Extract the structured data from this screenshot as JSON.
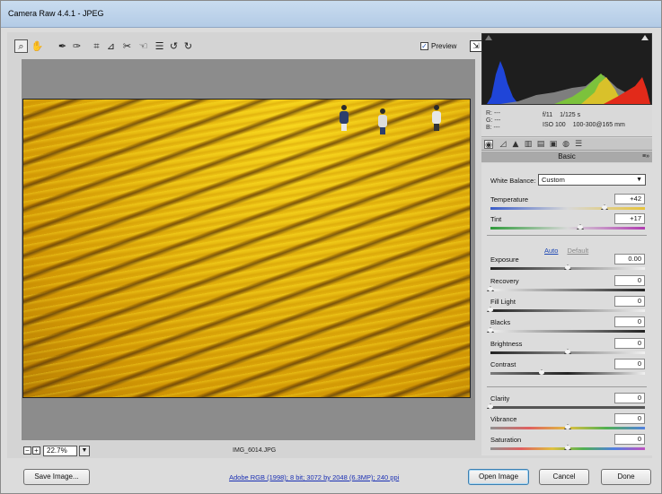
{
  "window": {
    "title": "Camera Raw 4.4.1  -  JPEG"
  },
  "toolbar": {
    "tools": [
      {
        "icon": "zoom-tool-icon",
        "glyph": "🔍",
        "active": true
      },
      {
        "icon": "hand-tool-icon",
        "glyph": "✋"
      },
      {
        "icon": "white-balance-tool-icon",
        "glyph": "✒"
      },
      {
        "icon": "color-sampler-tool-icon",
        "glyph": "✒"
      },
      {
        "icon": "crop-tool-icon",
        "glyph": "⌗"
      },
      {
        "icon": "straighten-tool-icon",
        "glyph": "⊿"
      },
      {
        "icon": "retouch-tool-icon",
        "glyph": "✂"
      },
      {
        "icon": "red-eye-tool-icon",
        "glyph": "☜"
      },
      {
        "icon": "preferences-icon",
        "glyph": "☰"
      },
      {
        "icon": "rotate-left-icon",
        "glyph": "↺"
      },
      {
        "icon": "rotate-right-icon",
        "glyph": "↻"
      }
    ],
    "preview_label": "Preview",
    "preview_checked": true
  },
  "status": {
    "zoom": "22.7%",
    "filename": "IMG_6014.JPG"
  },
  "readout": {
    "r": "R:  ---",
    "g": "G:  ---",
    "b": "B:  ---",
    "aperture": "f/11",
    "shutter": "1/125 s",
    "iso": "ISO 100",
    "lens": "100-300@165 mm"
  },
  "panel": {
    "title": "Basic",
    "white_balance_label": "White Balance:",
    "white_balance_value": "Custom",
    "auto_label": "Auto",
    "default_label": "Default",
    "sliders": [
      {
        "label": "Temperature",
        "value": "+42",
        "position": 0.74,
        "gradient": "linear-gradient(90deg,#3a5cc8,#d8d8d8 50%,#e7c33a)"
      },
      {
        "label": "Tint",
        "value": "+17",
        "position": 0.58,
        "gradient": "linear-gradient(90deg,#2e9a3a,#d8d8d8 50%,#b03ab0)"
      },
      {
        "label": "Exposure",
        "value": "0.00",
        "position": 0.5,
        "gradient": "linear-gradient(90deg,#222,#f0f0f0)"
      },
      {
        "label": "Recovery",
        "value": "0",
        "position": 0.0,
        "gradient": "linear-gradient(90deg,#f0f0f0,#222)"
      },
      {
        "label": "Fill Light",
        "value": "0",
        "position": 0.0,
        "gradient": "linear-gradient(90deg,#222,#f0f0f0)"
      },
      {
        "label": "Blacks",
        "value": "0",
        "position": 0.0,
        "gradient": "linear-gradient(90deg,#f0f0f0,#222)"
      },
      {
        "label": "Brightness",
        "value": "0",
        "position": 0.5,
        "gradient": "linear-gradient(90deg,#222,#f0f0f0)"
      },
      {
        "label": "Contrast",
        "value": "0",
        "position": 0.33,
        "gradient": "linear-gradient(90deg,#7a7a7a,#222 50%,#f0f0f0)"
      },
      {
        "label": "Clarity",
        "value": "0",
        "position": 0.0,
        "gradient": "linear-gradient(90deg,#555,#555)"
      },
      {
        "label": "Vibrance",
        "value": "0",
        "position": 0.5,
        "gradient": "linear-gradient(90deg,#909090,#e06060,#e0c040,#50b050,#5080e0)"
      },
      {
        "label": "Saturation",
        "value": "0",
        "position": 0.5,
        "gradient": "linear-gradient(90deg,#909090,#e06060,#e0c040,#50b050,#5080e0,#c050c0)"
      }
    ]
  },
  "footer": {
    "save_label": "Save Image...",
    "workflow_link": "Adobe RGB (1998); 8 bit; 3072 by 2048 (6.3MP); 240 ppi",
    "open_label": "Open Image",
    "cancel_label": "Cancel",
    "done_label": "Done"
  },
  "colors": {
    "accent_link": "#1a2fb3",
    "histogram_bg": "#1e1e1e"
  }
}
